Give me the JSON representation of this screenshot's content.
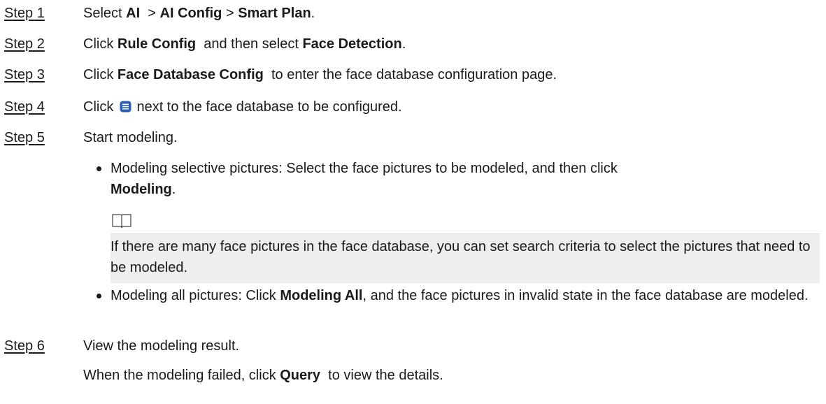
{
  "steps": [
    {
      "label": "Step 1",
      "pre": "Select ",
      "b1": "AI",
      "mid1": "  > ",
      "b2": "AI Config",
      "mid2": " > ",
      "b3": "Smart Plan",
      "post": "."
    },
    {
      "label": "Step 2",
      "pre": "Click ",
      "b1": "Rule Config",
      "mid1": "  and then select ",
      "b2": "Face Detection",
      "post": "."
    },
    {
      "label": "Step 3",
      "pre": "Click ",
      "b1": "Face Database Config",
      "post": "  to enter the face database configuration page."
    },
    {
      "label": "Step 4",
      "pre": "Click ",
      "post": " next to the face database to be configured.",
      "icon": "list-detail-icon"
    },
    {
      "label": "Step 5",
      "text": "Start modeling."
    },
    {
      "label": "Step 6",
      "text": "View the modeling result."
    }
  ],
  "bullet1": {
    "pre": "Modeling selective pictures: Select the face pictures to be modeled, and then click",
    "bold": "Modeling",
    "post": "."
  },
  "note": {
    "icon": "book-icon",
    "text": "If there are many face pictures in the face database, you can set search criteria to select the pictures that need to be modeled."
  },
  "bullet2": {
    "pre": "Modeling all pictures: Click ",
    "bold": "Modeling All",
    "post": ", and the face pictures in invalid state in the face database are modeled."
  },
  "step6_detail": {
    "pre": "When the modeling failed, click ",
    "bold": "Query",
    "post": "  to view the details."
  }
}
